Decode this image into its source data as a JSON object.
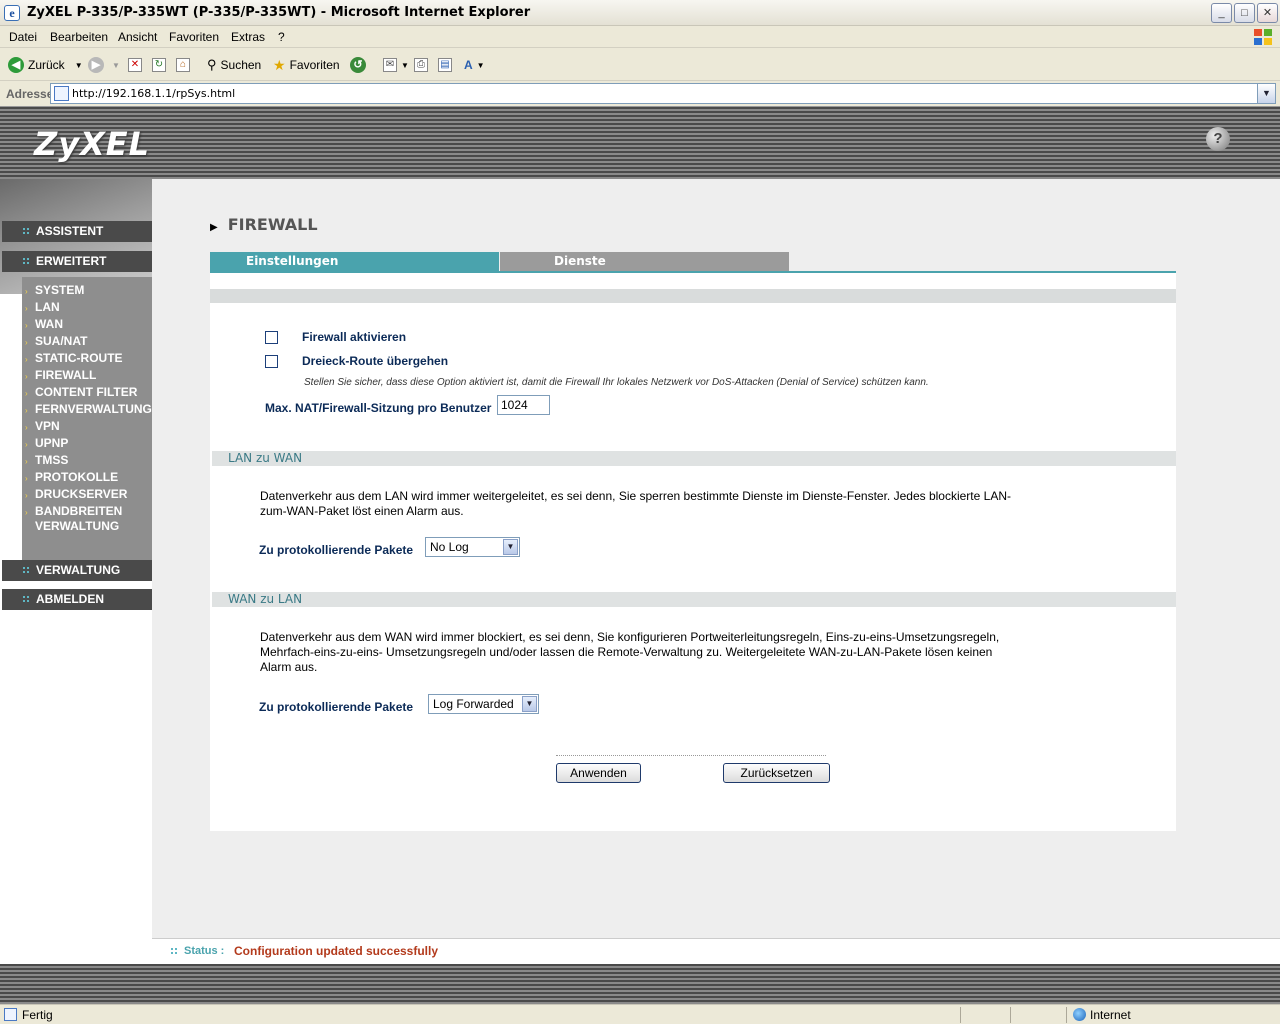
{
  "window": {
    "title": "ZyXEL P-335/P-335WT (P-335/P-335WT) - Microsoft Internet Explorer",
    "controls": {
      "minimize": "_",
      "maximize": "□",
      "close": "✕"
    }
  },
  "menu": [
    "Datei",
    "Bearbeiten",
    "Ansicht",
    "Favoriten",
    "Extras",
    "?"
  ],
  "toolbar": {
    "back": "Zurück",
    "search": "Suchen",
    "favorites": "Favoriten"
  },
  "address": {
    "label": "Adresse",
    "url": "http://192.168.1.1/rpSys.html"
  },
  "brand": {
    "logo": "ZyXEL",
    "help": "?"
  },
  "sidebar": {
    "assistant": "ASSISTENT",
    "advanced": "ERWEITERT",
    "items": [
      "SYSTEM",
      "LAN",
      "WAN",
      "SUA/NAT",
      "STATIC-ROUTE",
      "FIREWALL",
      "CONTENT FILTER",
      "FERNVERWALTUNG",
      "VPN",
      "UPNP",
      "TMSS",
      "PROTOKOLLE",
      "DRUCKSERVER",
      "BANDBREITEN",
      "VERWALTUNG"
    ],
    "management": "VERWALTUNG",
    "logout": "ABMELDEN"
  },
  "page": {
    "title": "FIREWALL",
    "tabs": [
      "Einstellungen",
      "Dienste"
    ],
    "settings": {
      "enable_firewall": {
        "label": "Firewall aktivieren",
        "checked": false
      },
      "bypass_triangle": {
        "label": "Dreieck-Route übergehen",
        "checked": false
      },
      "note": "Stellen Sie sicher, dass diese Option aktiviert ist, damit die Firewall Ihr lokales Netzwerk vor DoS-Attacken (Denial of Service) schützen kann.",
      "max_sessions_label": "Max. NAT/Firewall-Sitzung pro Benutzer",
      "max_sessions_value": "1024"
    },
    "lan_wan": {
      "heading": "LAN zu WAN",
      "desc_line1": "Datenverkehr aus dem LAN wird immer weitergeleitet, es sei denn, Sie sperren bestimmte Dienste im Dienste-Fenster. Jedes blockierte LAN-",
      "desc_line2": "zum-WAN-Paket löst einen Alarm aus.",
      "log_label": "Zu protokollierende Pakete",
      "log_value": "No Log"
    },
    "wan_lan": {
      "heading": "WAN zu LAN",
      "desc_line1": "Datenverkehr aus dem WAN wird immer blockiert, es sei denn, Sie konfigurieren Portweiterleitungsregeln, Eins-zu-eins-Umsetzungsregeln,",
      "desc_line2": "Mehrfach-eins-zu-eins- Umsetzungsregeln und/oder lassen die Remote-Verwaltung zu. Weitergeleitete WAN-zu-LAN-Pakete lösen keinen",
      "desc_line3": "Alarm aus.",
      "log_label": "Zu protokollierende Pakete",
      "log_value": "Log Forwarded"
    },
    "buttons": {
      "apply": "Anwenden",
      "reset": "Zurücksetzen"
    }
  },
  "status": {
    "label": "Status :",
    "message": "Configuration updated successfully"
  },
  "iestatus": {
    "ready": "Fertig",
    "zone": "Internet"
  },
  "colors": {
    "accent": "#4aa3ad",
    "status_msg": "#b33a1c",
    "label": "#0b2a57"
  }
}
